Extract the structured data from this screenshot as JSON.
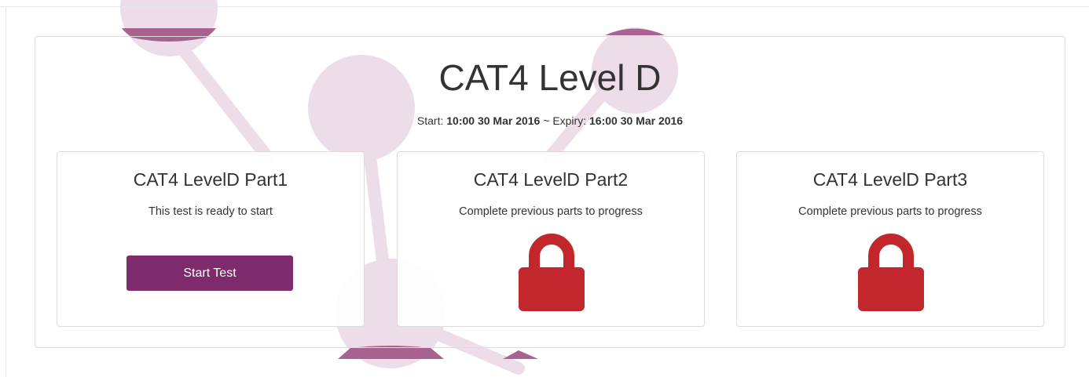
{
  "exam": {
    "title": "CAT4 Level D",
    "start_label": "Start:",
    "start_value": "10:00 30 Mar 2016",
    "separator": "~",
    "expiry_label": "Expiry:",
    "expiry_value": "16:00 30 Mar 2016"
  },
  "parts": [
    {
      "title": "CAT4 LevelD Part1",
      "message": "This test is ready to start",
      "button_label": "Start Test",
      "state": "ready"
    },
    {
      "title": "CAT4 LevelD Part2",
      "message": "Complete previous parts to progress",
      "icon": "lock-icon",
      "state": "locked"
    },
    {
      "title": "CAT4 LevelD Part3",
      "message": "Complete previous parts to progress",
      "icon": "lock-icon",
      "state": "locked"
    }
  ],
  "colors": {
    "accent": "#7d2b6c",
    "lock": "#c1272d",
    "decoration_light": "#ecdde8",
    "decoration_dark": "#a8628f"
  }
}
